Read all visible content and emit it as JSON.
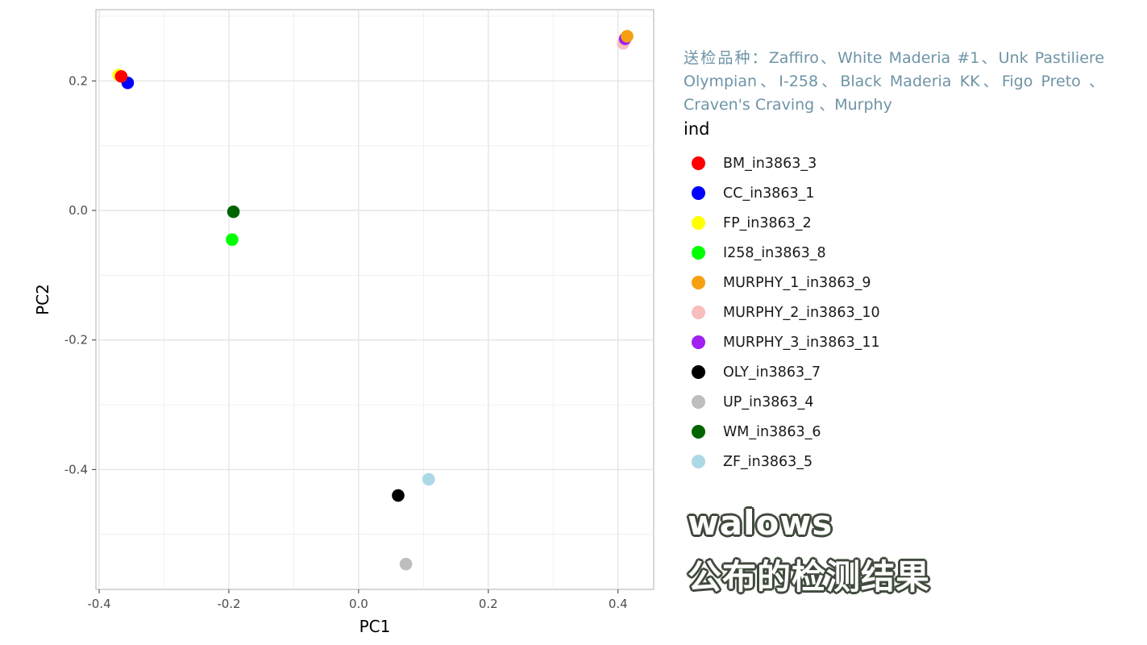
{
  "note": "送检品种：Zaffiro、White Maderia #1、Unk Pastiliere Olympian、I-258、Black Maderia KK、Figo Preto 、Craven's Craving 、Murphy",
  "overlay": {
    "line1": "walows",
    "line2": "公布的检测结果"
  },
  "chart_data": {
    "type": "scatter",
    "xlabel": "PC1",
    "ylabel": "PC2",
    "xlim": [
      -0.405,
      0.455
    ],
    "ylim": [
      -0.585,
      0.31
    ],
    "x_ticks": [
      -0.4,
      -0.2,
      0.0,
      0.2,
      0.4
    ],
    "x_tick_labels": [
      "-0.4",
      "-0.2",
      "0.0",
      "0.2",
      "0.4"
    ],
    "y_ticks": [
      -0.4,
      -0.2,
      0.0,
      0.2
    ],
    "y_tick_labels": [
      "-0.4",
      "-0.2",
      "0.0",
      "0.2"
    ],
    "grid": true,
    "legend": {
      "title": "ind",
      "placement": "right"
    },
    "series": [
      {
        "name": "BM_in3863_3",
        "color": "#ff0000",
        "x": -0.366,
        "y": 0.207
      },
      {
        "name": "CC_in3863_1",
        "color": "#0000ff",
        "x": -0.356,
        "y": 0.197
      },
      {
        "name": "FP_in3863_2",
        "color": "#ffff00",
        "x": -0.37,
        "y": 0.209
      },
      {
        "name": "I258_in3863_8",
        "color": "#00ff00",
        "x": -0.195,
        "y": -0.045
      },
      {
        "name": "MURPHY_1_in3863_9",
        "color": "#f5a010",
        "x": 0.414,
        "y": 0.269
      },
      {
        "name": "MURPHY_2_in3863_10",
        "color": "#f8bdbd",
        "x": 0.408,
        "y": 0.258
      },
      {
        "name": "MURPHY_3_in3863_11",
        "color": "#a020f0",
        "x": 0.411,
        "y": 0.265
      },
      {
        "name": "OLY_in3863_7",
        "color": "#000000",
        "x": 0.061,
        "y": -0.44
      },
      {
        "name": "UP_in3863_4",
        "color": "#bebebe",
        "x": 0.073,
        "y": -0.546
      },
      {
        "name": "WM_in3863_6",
        "color": "#006400",
        "x": -0.193,
        "y": -0.002
      },
      {
        "name": "ZF_in3863_5",
        "color": "#add8e6",
        "x": 0.108,
        "y": -0.415
      }
    ],
    "draw_order": [
      "UP_in3863_4",
      "OLY_in3863_7",
      "ZF_in3863_5",
      "I258_in3863_8",
      "WM_in3863_6",
      "CC_in3863_1",
      "FP_in3863_2",
      "BM_in3863_3",
      "MURPHY_2_in3863_10",
      "MURPHY_3_in3863_11",
      "MURPHY_1_in3863_9"
    ]
  }
}
